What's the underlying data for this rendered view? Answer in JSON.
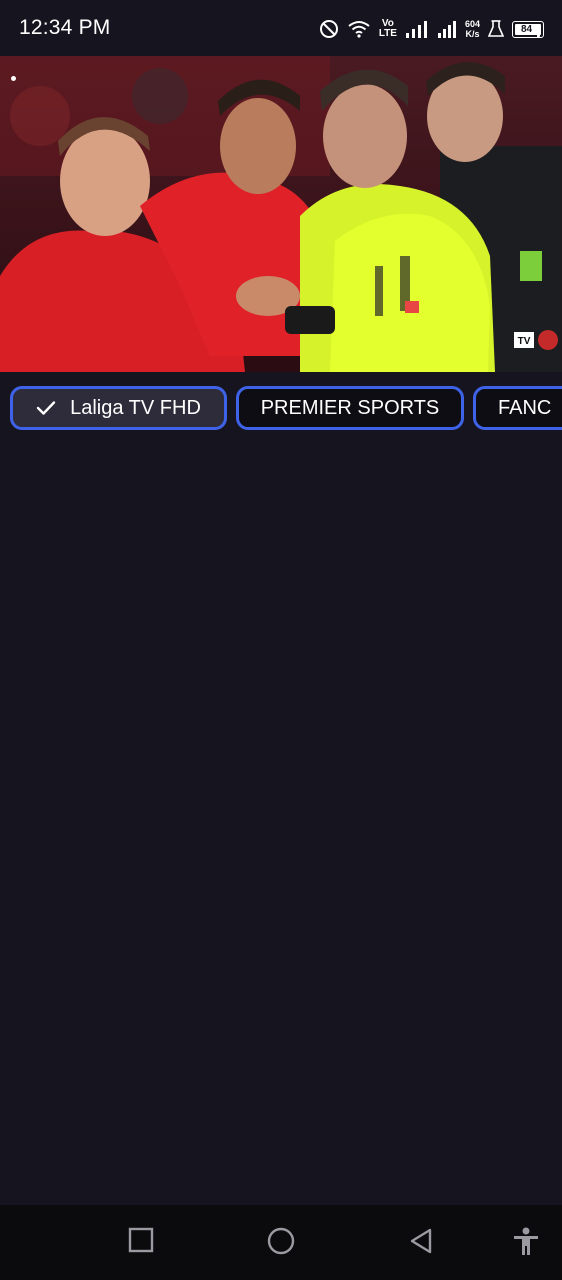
{
  "status_bar": {
    "time": "12:34 PM",
    "volte_top": "Vo",
    "volte_bottom": "LTE",
    "net_speed_value": "604",
    "net_speed_unit": "K/s",
    "battery_level": "84",
    "icons": [
      "do-not-disturb-icon",
      "wifi-icon",
      "signal-icon",
      "signal-icon",
      "beaker-icon",
      "battery-icon"
    ]
  },
  "video": {
    "watermark": "TV"
  },
  "channels": {
    "items": [
      {
        "label": "Laliga TV FHD",
        "selected": true
      },
      {
        "label": "PREMIER SPORTS",
        "selected": false
      },
      {
        "label": "FANC",
        "selected": false
      }
    ],
    "accent_color": "#3f63e8"
  },
  "nav_bar": {
    "icons": [
      "recent-apps-icon",
      "home-icon",
      "back-icon",
      "accessibility-icon"
    ]
  }
}
